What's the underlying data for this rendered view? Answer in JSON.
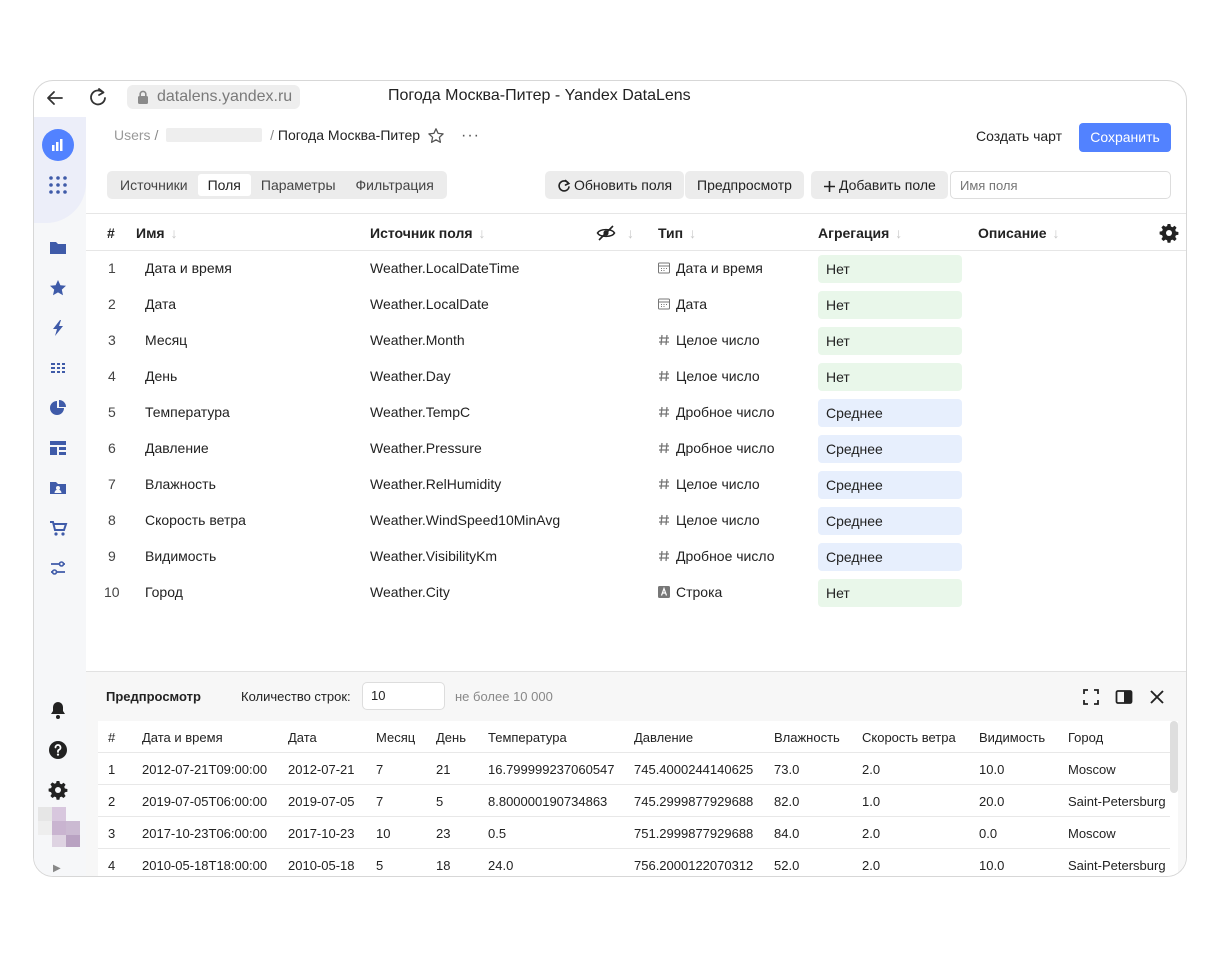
{
  "browser": {
    "url": "datalens.yandex.ru",
    "title": "Погода Москва-Питер - Yandex DataLens"
  },
  "breadcrumbs": {
    "root": "Users",
    "separator": "/",
    "current": "Погода Москва-Питер",
    "more": "···"
  },
  "header": {
    "create_chart": "Создать чарт",
    "save": "Сохранить"
  },
  "tabs": [
    {
      "label": "Источники",
      "active": false
    },
    {
      "label": "Поля",
      "active": true
    },
    {
      "label": "Параметры",
      "active": false
    },
    {
      "label": "Фильтрация",
      "active": false
    }
  ],
  "toolbar": {
    "refresh": "Обновить поля",
    "preview": "Предпросмотр",
    "add_field": "Добавить поле",
    "search_placeholder": "Имя поля"
  },
  "fields_table": {
    "headers": {
      "num": "#",
      "name": "Имя",
      "source": "Источник поля",
      "type": "Тип",
      "aggregation": "Агрегация",
      "description": "Описание"
    },
    "rows": [
      {
        "num": "1",
        "name": "Дата и время",
        "source": "Weather.LocalDateTime",
        "type": "Дата и время",
        "type_icon": "datetime-icon",
        "aggregation": "Нет",
        "agg_kind": "none"
      },
      {
        "num": "2",
        "name": "Дата",
        "source": "Weather.LocalDate",
        "type": "Дата",
        "type_icon": "date-icon",
        "aggregation": "Нет",
        "agg_kind": "none"
      },
      {
        "num": "3",
        "name": "Месяц",
        "source": "Weather.Month",
        "type": "Целое число",
        "type_icon": "hash-icon",
        "aggregation": "Нет",
        "agg_kind": "none"
      },
      {
        "num": "4",
        "name": "День",
        "source": "Weather.Day",
        "type": "Целое число",
        "type_icon": "hash-icon",
        "aggregation": "Нет",
        "agg_kind": "none"
      },
      {
        "num": "5",
        "name": "Температура",
        "source": "Weather.TempC",
        "type": "Дробное число",
        "type_icon": "hash-icon",
        "aggregation": "Среднее",
        "agg_kind": "avg"
      },
      {
        "num": "6",
        "name": "Давление",
        "source": "Weather.Pressure",
        "type": "Дробное число",
        "type_icon": "hash-icon",
        "aggregation": "Среднее",
        "agg_kind": "avg"
      },
      {
        "num": "7",
        "name": "Влажность",
        "source": "Weather.RelHumidity",
        "type": "Целое число",
        "type_icon": "hash-icon",
        "aggregation": "Среднее",
        "agg_kind": "avg"
      },
      {
        "num": "8",
        "name": "Скорость ветра",
        "source": "Weather.WindSpeed10MinAvg",
        "type": "Целое число",
        "type_icon": "hash-icon",
        "aggregation": "Среднее",
        "agg_kind": "avg"
      },
      {
        "num": "9",
        "name": "Видимость",
        "source": "Weather.VisibilityKm",
        "type": "Дробное число",
        "type_icon": "hash-icon",
        "aggregation": "Среднее",
        "agg_kind": "avg"
      },
      {
        "num": "10",
        "name": "Город",
        "source": "Weather.City",
        "type": "Строка",
        "type_icon": "string-icon",
        "aggregation": "Нет",
        "agg_kind": "none"
      }
    ]
  },
  "preview": {
    "title": "Предпросмотр",
    "row_count_label": "Количество строк:",
    "row_count": "10",
    "limit_note": "не более 10 000",
    "headers": [
      "#",
      "Дата и время",
      "Дата",
      "Месяц",
      "День",
      "Температура",
      "Давление",
      "Влажность",
      "Скорость ветра",
      "Видимость",
      "Город"
    ],
    "rows": [
      [
        "1",
        "2012-07-21T09:00:00",
        "2012-07-21",
        "7",
        "21",
        "16.799999237060547",
        "745.4000244140625",
        "73.0",
        "2.0",
        "10.0",
        "Moscow"
      ],
      [
        "2",
        "2019-07-05T06:00:00",
        "2019-07-05",
        "7",
        "5",
        "8.800000190734863",
        "745.2999877929688",
        "82.0",
        "1.0",
        "20.0",
        "Saint-Petersburg"
      ],
      [
        "3",
        "2017-10-23T06:00:00",
        "2017-10-23",
        "10",
        "23",
        "0.5",
        "751.2999877929688",
        "84.0",
        "2.0",
        "0.0",
        "Moscow"
      ],
      [
        "4",
        "2010-05-18T18:00:00",
        "2010-05-18",
        "5",
        "18",
        "24.0",
        "756.2000122070312",
        "52.0",
        "2.0",
        "10.0",
        "Saint-Petersburg"
      ]
    ]
  },
  "colors": {
    "accent": "#5282ff",
    "agg_none": "#e9f7ea",
    "agg_avg": "#e7effd",
    "nav_icon": "#3f5ba9"
  }
}
